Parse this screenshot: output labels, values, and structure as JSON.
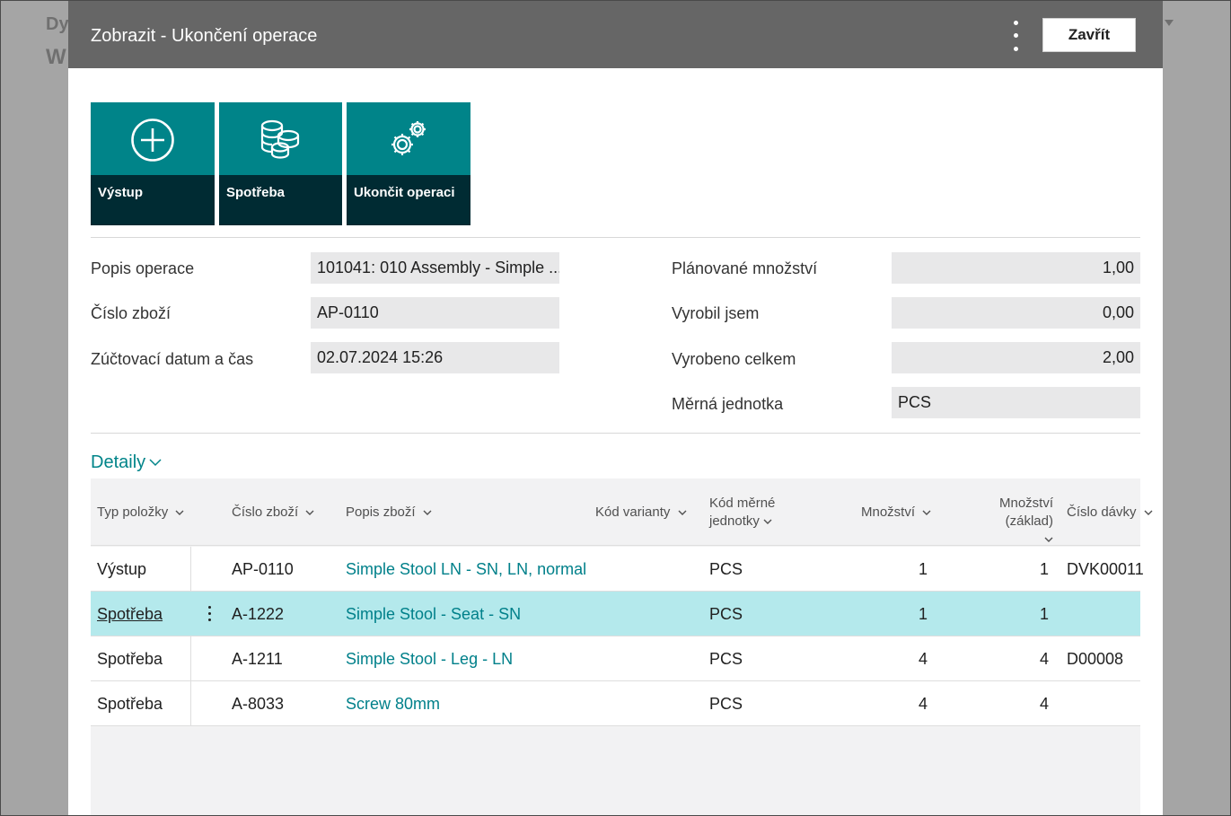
{
  "background": {
    "title_fragment": "Dy",
    "subtitle_fragment": "W"
  },
  "dialog": {
    "title": "Zobrazit - Ukončení operace",
    "close_label": "Zavřít"
  },
  "tiles": [
    {
      "label": "Výstup",
      "icon": "plus-circle-icon"
    },
    {
      "label": "Spotřeba",
      "icon": "coins-icon"
    },
    {
      "label": "Ukončit operaci",
      "icon": "gears-icon"
    }
  ],
  "fields": {
    "popis_operace": {
      "label": "Popis operace",
      "value": "101041: 010 Assembly - Simple ..."
    },
    "cislo_zbozi": {
      "label": "Číslo zboží",
      "value": "AP-0110"
    },
    "zuctovaci_datum": {
      "label": "Zúčtovací datum a čas",
      "value": "02.07.2024 15:26"
    },
    "planovane_mnozstvi": {
      "label": "Plánované množství",
      "value": "1,00"
    },
    "vyrobil_jsem": {
      "label": "Vyrobil jsem",
      "value": "0,00"
    },
    "vyrobeno_celkem": {
      "label": "Vyrobeno celkem",
      "value": "2,00"
    },
    "merna_jednotka": {
      "label": "Měrná jednotka",
      "value": "PCS"
    }
  },
  "details": {
    "label": "Detaily"
  },
  "table": {
    "columns": {
      "typ": "Typ položky",
      "cislo": "Číslo zboží",
      "popis": "Popis zboží",
      "varianta": "Kód varianty",
      "kod_mj_1": "Kód měrné",
      "kod_mj_2": "jednotky",
      "mnozstvi": "Množství",
      "mnozstvi_zaklad": "Množství (základ)",
      "davka": "Číslo dávky"
    },
    "rows": [
      {
        "typ": "Výstup",
        "cislo": "AP-0110",
        "popis": "Simple Stool LN - SN, LN, normal",
        "varianta": "",
        "mj": "PCS",
        "mnozstvi": "1",
        "zaklad": "1",
        "davka": "DVK00011"
      },
      {
        "typ": "Spotřeba",
        "cislo": "A-1222",
        "popis": "Simple Stool - Seat - SN",
        "varianta": "",
        "mj": "PCS",
        "mnozstvi": "1",
        "zaklad": "1",
        "davka": ""
      },
      {
        "typ": "Spotřeba",
        "cislo": "A-1211",
        "popis": "Simple Stool - Leg - LN",
        "varianta": "",
        "mj": "PCS",
        "mnozstvi": "4",
        "zaklad": "4",
        "davka": "D00008"
      },
      {
        "typ": "Spotřeba",
        "cislo": "A-8033",
        "popis": "Screw 80mm",
        "varianta": "",
        "mj": "PCS",
        "mnozstvi": "4",
        "zaklad": "4",
        "davka": ""
      }
    ],
    "selected_row": 1
  },
  "colors": {
    "accent": "#008489",
    "tile_dark": "#002b33",
    "header": "#666666",
    "selected_row": "#b4e9ec",
    "link": "#00808a"
  }
}
